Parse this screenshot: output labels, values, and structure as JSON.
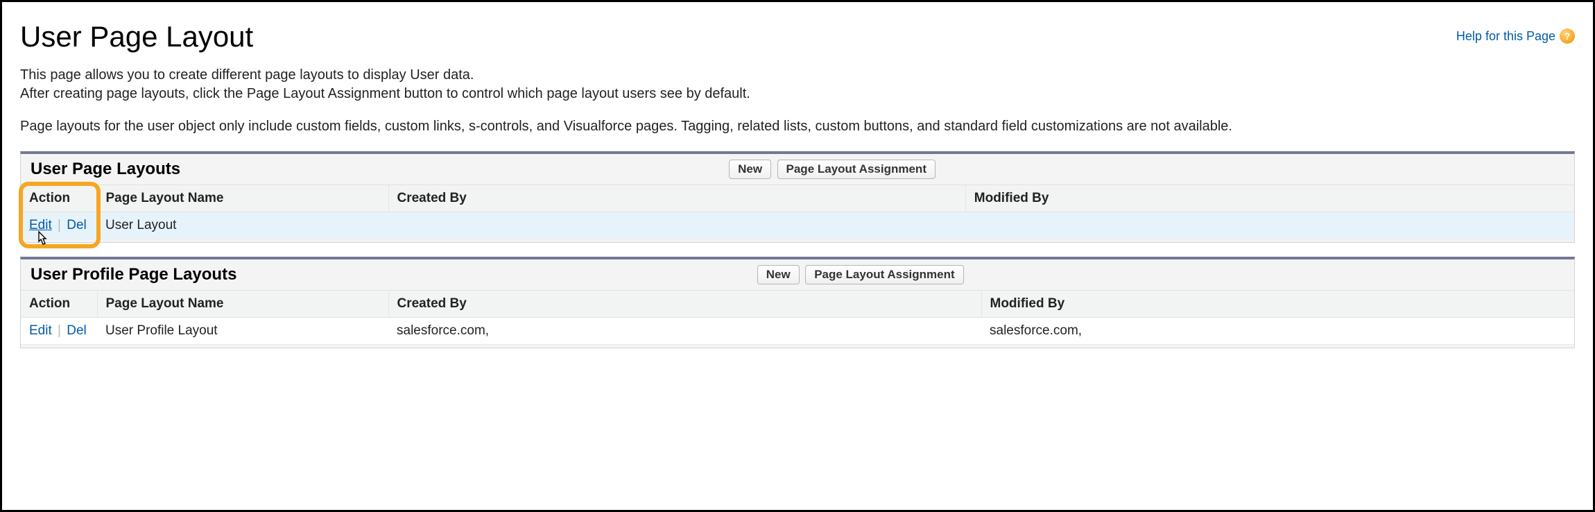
{
  "header": {
    "title": "User Page Layout",
    "help_label": "Help for this Page"
  },
  "intro": {
    "line1": "This page allows you to create different page layouts to display User data.",
    "line2": "After creating page layouts, click the Page Layout Assignment button to control which page layout users see by default.",
    "para2": "Page layouts for the user object only include custom fields, custom links, s-controls, and Visualforce pages. Tagging, related lists, custom buttons, and standard field customizations are not available."
  },
  "buttons": {
    "new": "New",
    "assignment": "Page Layout Assignment"
  },
  "columns": {
    "action": "Action",
    "name": "Page Layout Name",
    "created_by": "Created By",
    "modified_by": "Modified By"
  },
  "actions": {
    "edit": "Edit",
    "del": "Del"
  },
  "sections": {
    "user_page_layouts": {
      "title": "User Page Layouts",
      "rows": [
        {
          "name": "User Layout",
          "created_by": "",
          "modified_by": ""
        }
      ]
    },
    "user_profile_page_layouts": {
      "title": "User Profile Page Layouts",
      "rows": [
        {
          "name": "User Profile Layout",
          "created_by": "salesforce.com,",
          "modified_by": "salesforce.com,"
        }
      ]
    }
  }
}
